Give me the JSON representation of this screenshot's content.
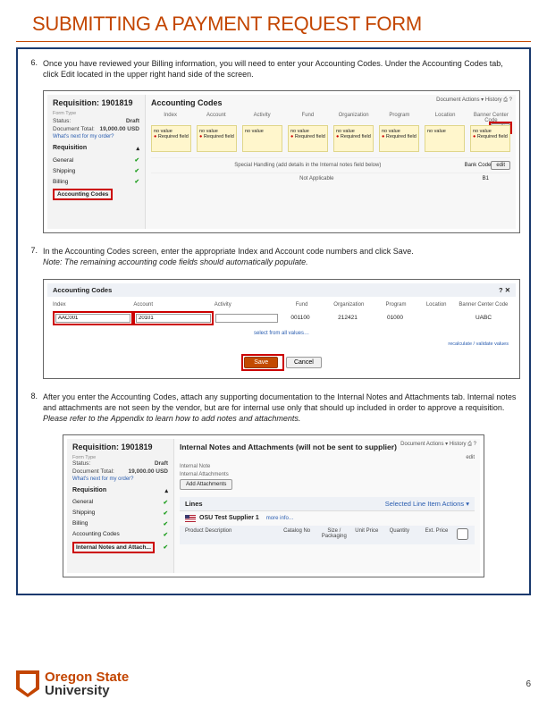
{
  "title": "SUBMITTING A PAYMENT REQUEST FORM",
  "page_number": "6",
  "footer": {
    "org1": "Oregon State",
    "org2": "University"
  },
  "steps": {
    "s6": {
      "num": "6.",
      "text": "Once you have reviewed your Billing information, you will need to enter your Accounting Codes.  Under the Accounting Codes tab, click Edit located in the upper right hand side of the screen."
    },
    "s7": {
      "num": "7.",
      "text": "In the Accounting Codes screen, enter the appropriate Index and Account code numbers and click Save.",
      "note": "Note: The remaining accounting code fields should automatically populate."
    },
    "s8": {
      "num": "8.",
      "text_a": "After you enter the Accounting Codes, attach any supporting documentation to the Internal Notes and Attachments tab.  Internal notes and attachments are not seen by the vendor, but are for internal use only that should up included in order to approve a requisition.  ",
      "text_b": "Please refer to the Appendix to learn how to add notes and attachments."
    }
  },
  "sc1": {
    "req_header": "Requisition: 1901819",
    "ac_header": "Accounting Codes",
    "form_type_label": "Form Type",
    "status_label": "Status:",
    "status_val": "Draft",
    "doctotal_label": "Document Total:",
    "doctotal_val": "19,000.00 USD",
    "whats_next": "What's next for my order?",
    "req_acc": "Requisition",
    "nav": [
      "General",
      "Shipping",
      "Billing",
      "Accounting Codes"
    ],
    "top_actions": "Document Actions ▾    History    ⎙    ?",
    "edit": "edit",
    "cols": [
      "Index",
      "Account",
      "Activity",
      "Fund",
      "Organization",
      "Program",
      "Location",
      "Banner Center Code"
    ],
    "nv_title": "no value",
    "nv_req": "Required field",
    "sp_label": "Special Handling (add details in the Internal notes field below)",
    "sp_na": "Not Applicable",
    "bank_label": "Bank Code",
    "bank_val": "B1"
  },
  "sc2": {
    "hdr": "Accounting Codes",
    "close": "?  ✕",
    "cols": [
      "Index",
      "Account",
      "Activity",
      "Fund",
      "Organization",
      "Program",
      "Location",
      "Banner Center Code"
    ],
    "index_val": "AAC001",
    "account_val": "20101",
    "fund": "001100",
    "org": "212421",
    "prog": "01000",
    "ccode": "UABC",
    "selall": "select from all values…",
    "recalc": "recalculate / validate values",
    "save": "Save",
    "cancel": "Cancel"
  },
  "sc3": {
    "req_header": "Requisition: 1901819",
    "int_header": "Internal Notes and Attachments (will not be sent to supplier)",
    "form_type": "Form Type",
    "status_label": "Status:",
    "status_val": "Draft",
    "doctotal_label": "Document Total:",
    "doctotal_val": "19,000.00 USD",
    "whats_next": "What's next for my order?",
    "req_acc": "Requisition",
    "nav": [
      "General",
      "Shipping",
      "Billing",
      "Accounting Codes",
      "Internal Notes and Attach..."
    ],
    "top_actions": "Document Actions ▾   History   ⎙   ?",
    "edit": "edit",
    "int_note": "Internal Note",
    "int_att": "Internal Attachments",
    "add_att": "Add Attachments",
    "lines": "Lines",
    "lines_act": "Selected Line Item Actions ▾",
    "supplier": "OSU Test Supplier 1",
    "more": "more info…",
    "prod_cols": [
      "Product Description",
      "Catalog No",
      "Size / Packaging",
      "Unit Price",
      "Quantity",
      "Ext. Price",
      ""
    ]
  }
}
